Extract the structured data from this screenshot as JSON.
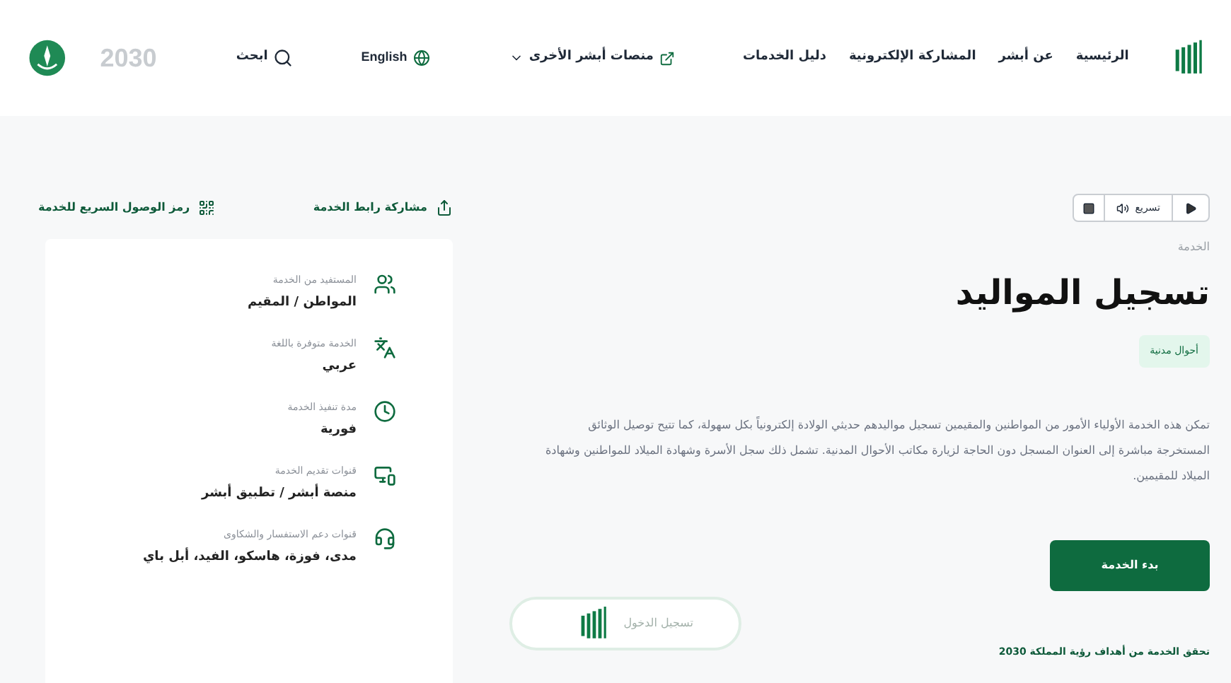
{
  "header": {
    "nav": [
      "الرئيسية",
      "عن أبشر",
      "المشاركة الإلكترونية",
      "دليل الخدمات"
    ],
    "platforms": "منصات أبشر الأخرى",
    "language": "English",
    "search": "ابحث",
    "vision": "2030"
  },
  "reader": {
    "speed": "تسريع"
  },
  "breadcrumb": "الخدمة",
  "title": "تسجيل المواليد",
  "tag": "أحوال مدنية",
  "description": "تمكن هذه الخدمة الأولياء الأمور من المواطنين والمقيمين تسجيل مواليدهم حديثي الولادة إلكترونياً بكل سهولة، كما تتيح توصيل الوثائق المستخرجة مباشرة إلى العنوان المسجل دون الحاجة لزيارة مكاتب الأحوال المدنية. تشمل ذلك سجل الأسرة وشهادة الميلاد للمواطنين وشهادة الميلاد للمقيمين.",
  "start_button": "بدء الخدمة",
  "login": "تسجيل الدخول",
  "vision_note": "تحقق الخدمة من أهداف رؤية المملكة 2030",
  "share": "مشاركة رابط الخدمة",
  "qr": "رمز الوصول السريع للخدمة",
  "details": [
    {
      "kind": "people",
      "label": "المستفيد من الخدمة",
      "value": "المواطن / المقيم"
    },
    {
      "kind": "language",
      "label": "الخدمة متوفرة باللغة",
      "value": "عربي"
    },
    {
      "kind": "clock",
      "label": "مدة تنفيذ الخدمة",
      "value": "فورية"
    },
    {
      "kind": "channels",
      "label": "قنوات تقديم الخدمة",
      "value": "منصة أبشر / تطبيق أبشر"
    },
    {
      "kind": "support",
      "label": "قنوات دعم الاستفسار والشكاوى",
      "value": "مدى، فوزة، هاسكو، الفيد، أبل باي"
    }
  ]
}
